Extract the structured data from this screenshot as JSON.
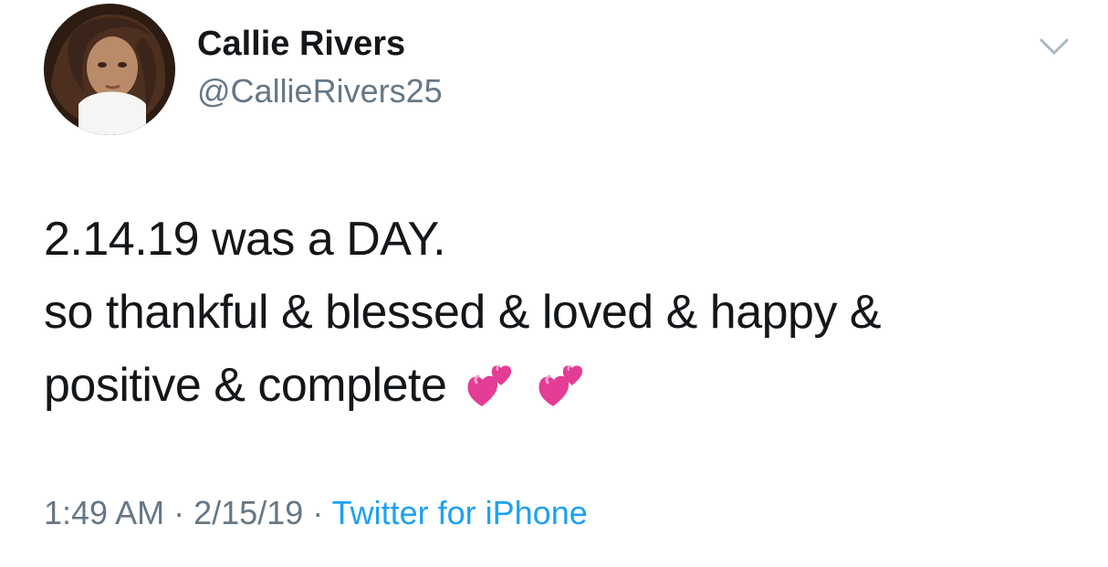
{
  "tweet": {
    "author": {
      "name": "Callie Rivers",
      "handle": "@CallieRivers25"
    },
    "text_lines": [
      "2.14.19 was a DAY.",
      "so thankful & blessed & loved & happy &",
      "positive & complete"
    ],
    "emoji": [
      "two-hearts-icon",
      "two-hearts-icon"
    ],
    "time": "1:49 AM",
    "separator": "·",
    "date": "2/15/19",
    "source": "Twitter for iPhone"
  },
  "colors": {
    "text": "#14171a",
    "muted": "#657786",
    "link": "#1da1f2"
  }
}
